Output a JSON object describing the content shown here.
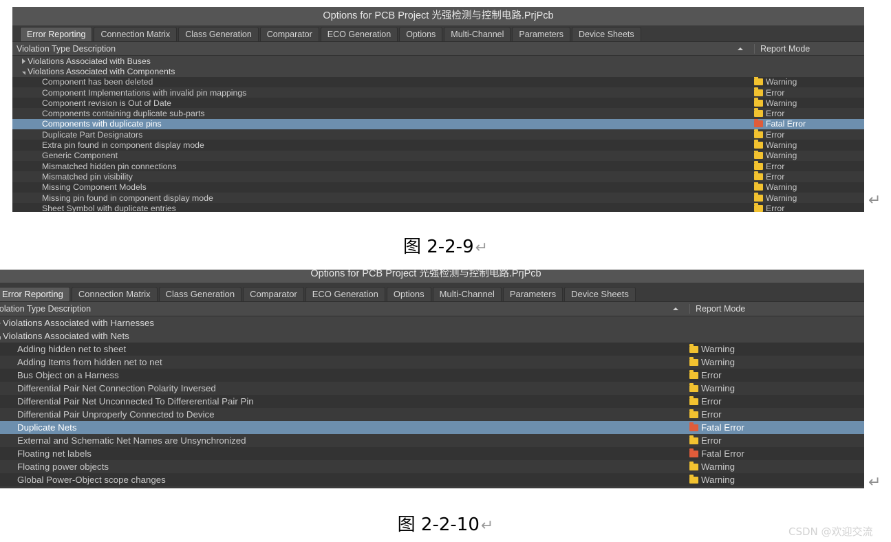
{
  "page": {
    "background": "#ffffff",
    "watermark": "CSDN @欢迎交流"
  },
  "colors": {
    "dialog_bg": "#3b3b3b",
    "titlebar_bg": "#555555",
    "row_odd": "#333333",
    "row_even": "#3a3a3a",
    "group_row": "#434343",
    "selection": "#6d8fae",
    "warning_icon": "#f2c230",
    "error_icon": "#f2c230",
    "fatal_icon": "#e05c3a",
    "text": "#c9c9c9"
  },
  "tabs": [
    {
      "label": "Error Reporting",
      "active": true
    },
    {
      "label": "Connection Matrix",
      "active": false
    },
    {
      "label": "Class Generation",
      "active": false
    },
    {
      "label": "Comparator",
      "active": false
    },
    {
      "label": "ECO Generation",
      "active": false
    },
    {
      "label": "Options",
      "active": false
    },
    {
      "label": "Multi-Channel",
      "active": false
    },
    {
      "label": "Parameters",
      "active": false
    },
    {
      "label": "Device Sheets",
      "active": false
    }
  ],
  "columns": {
    "description": "Violation Type Description",
    "report_mode": "Report Mode",
    "sort_direction": "ascending"
  },
  "dialog1": {
    "title": "Options for PCB Project 光强检测与控制电路.PrjPcb",
    "rows": [
      {
        "level": 0,
        "twisty": "collapsed",
        "desc": "Violations Associated with Buses",
        "mode": "",
        "icon": "",
        "selected": false
      },
      {
        "level": 0,
        "twisty": "expanded",
        "desc": "Violations Associated with Components",
        "mode": "",
        "icon": "",
        "selected": false
      },
      {
        "level": 1,
        "twisty": "",
        "desc": "Component has been deleted",
        "mode": "Warning",
        "icon": "warn",
        "selected": false
      },
      {
        "level": 1,
        "twisty": "",
        "desc": "Component Implementations with invalid pin mappings",
        "mode": "Error",
        "icon": "err",
        "selected": false
      },
      {
        "level": 1,
        "twisty": "",
        "desc": "Component revision is Out of Date",
        "mode": "Warning",
        "icon": "warn",
        "selected": false
      },
      {
        "level": 1,
        "twisty": "",
        "desc": "Components containing duplicate sub-parts",
        "mode": "Error",
        "icon": "err",
        "selected": false
      },
      {
        "level": 1,
        "twisty": "",
        "desc": "Components with duplicate pins",
        "mode": "Fatal Error",
        "icon": "fatal",
        "selected": true
      },
      {
        "level": 1,
        "twisty": "",
        "desc": "Duplicate Part Designators",
        "mode": "Error",
        "icon": "err",
        "selected": false
      },
      {
        "level": 1,
        "twisty": "",
        "desc": "Extra pin found in component display mode",
        "mode": "Warning",
        "icon": "warn",
        "selected": false
      },
      {
        "level": 1,
        "twisty": "",
        "desc": "Generic Component",
        "mode": "Warning",
        "icon": "warn",
        "selected": false
      },
      {
        "level": 1,
        "twisty": "",
        "desc": "Mismatched hidden pin connections",
        "mode": "Error",
        "icon": "err",
        "selected": false
      },
      {
        "level": 1,
        "twisty": "",
        "desc": "Mismatched pin visibility",
        "mode": "Error",
        "icon": "err",
        "selected": false
      },
      {
        "level": 1,
        "twisty": "",
        "desc": "Missing Component Models",
        "mode": "Warning",
        "icon": "warn",
        "selected": false
      },
      {
        "level": 1,
        "twisty": "",
        "desc": "Missing pin found in component display mode",
        "mode": "Warning",
        "icon": "warn",
        "selected": false
      },
      {
        "level": 1,
        "twisty": "",
        "desc": "Sheet Symbol with duplicate entries",
        "mode": "Error",
        "icon": "err",
        "selected": false
      }
    ]
  },
  "dialog2": {
    "title": "Options for PCB Project 光强检测与控制电路.PrjPcb",
    "rows": [
      {
        "level": 0,
        "twisty": "collapsed",
        "desc": "Violations Associated with Harnesses",
        "mode": "",
        "icon": "",
        "selected": false
      },
      {
        "level": 0,
        "twisty": "expanded",
        "desc": "Violations Associated with Nets",
        "mode": "",
        "icon": "",
        "selected": false
      },
      {
        "level": 1,
        "twisty": "",
        "desc": "Adding hidden net to sheet",
        "mode": "Warning",
        "icon": "warn",
        "selected": false
      },
      {
        "level": 1,
        "twisty": "",
        "desc": "Adding Items from hidden net to net",
        "mode": "Warning",
        "icon": "warn",
        "selected": false
      },
      {
        "level": 1,
        "twisty": "",
        "desc": "Bus Object on a Harness",
        "mode": "Error",
        "icon": "err",
        "selected": false
      },
      {
        "level": 1,
        "twisty": "",
        "desc": "Differential Pair Net Connection Polarity Inversed",
        "mode": "Warning",
        "icon": "warn",
        "selected": false
      },
      {
        "level": 1,
        "twisty": "",
        "desc": "Differential Pair Net Unconnected To Differerential Pair Pin",
        "mode": "Error",
        "icon": "err",
        "selected": false
      },
      {
        "level": 1,
        "twisty": "",
        "desc": "Differential Pair Unproperly Connected to Device",
        "mode": "Error",
        "icon": "err",
        "selected": false
      },
      {
        "level": 1,
        "twisty": "",
        "desc": "Duplicate Nets",
        "mode": "Fatal Error",
        "icon": "fatal",
        "selected": true
      },
      {
        "level": 1,
        "twisty": "",
        "desc": "External and Schematic Net Names are Unsynchronized",
        "mode": "Error",
        "icon": "err",
        "selected": false
      },
      {
        "level": 1,
        "twisty": "",
        "desc": "Floating net labels",
        "mode": "Fatal Error",
        "icon": "fatal",
        "selected": false
      },
      {
        "level": 1,
        "twisty": "",
        "desc": "Floating power objects",
        "mode": "Warning",
        "icon": "warn",
        "selected": false
      },
      {
        "level": 1,
        "twisty": "",
        "desc": "Global Power-Object scope changes",
        "mode": "Warning",
        "icon": "warn",
        "selected": false
      }
    ]
  },
  "captions": {
    "figure1": "图 2-2-9",
    "figure2": "图 2-2-10",
    "return_mark": "↵"
  }
}
